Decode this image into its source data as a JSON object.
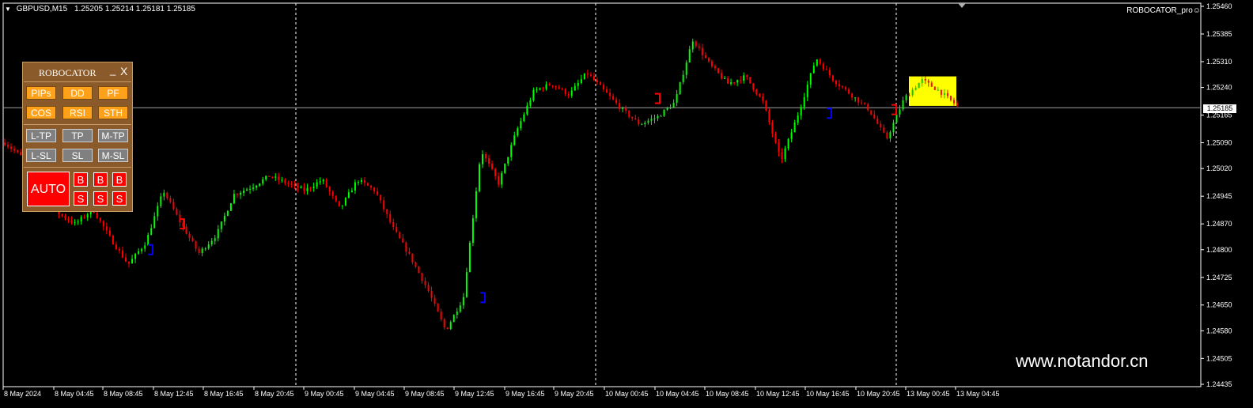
{
  "header": {
    "symbol": "GBPUSD,M15",
    "ohlc": "1.25205 1.25214 1.25181 1.25185"
  },
  "indicator_name": "ROBOCATOR_pro",
  "current_price": "1.25185",
  "watermark": "www.notandor.cn",
  "chart_data": {
    "type": "candlestick",
    "price_axis": [
      "1.25460",
      "1.25385",
      "1.25310",
      "1.25240",
      "1.25165",
      "1.25090",
      "1.25020",
      "1.24945",
      "1.24870",
      "1.24800",
      "1.24725",
      "1.24650",
      "1.24580",
      "1.24505",
      "1.24435"
    ],
    "ylim": [
      1.24435,
      1.2546
    ],
    "time_axis": [
      "8 May 2024",
      "8 May 04:45",
      "8 May 08:45",
      "8 May 12:45",
      "8 May 16:45",
      "8 May 20:45",
      "9 May 00:45",
      "9 May 04:45",
      "9 May 08:45",
      "9 May 12:45",
      "9 May 16:45",
      "9 May 20:45",
      "10 May 00:45",
      "10 May 04:45",
      "10 May 08:45",
      "10 May 12:45",
      "10 May 16:45",
      "10 May 20:45",
      "13 May 00:45",
      "13 May 04:45"
    ],
    "period_separators": [
      "9 May 00:45",
      "10 May 00:45",
      "13 May 00:45"
    ],
    "bid_line": 1.25185,
    "colors": {
      "bull": "#00ff00",
      "bear": "#ff0000",
      "bg": "#000000",
      "axis": "#ffffff",
      "zone": "#ffff00",
      "marker_buy": "#0000ff",
      "marker_sell": "#ff0000"
    },
    "path_anchors": [
      1.2509,
      1.2505,
      1.2495,
      1.249,
      1.2487,
      1.2491,
      1.2483,
      1.2476,
      1.2482,
      1.2496,
      1.2487,
      1.2479,
      1.2484,
      1.2495,
      1.2497,
      1.25,
      1.2498,
      1.2496,
      1.2499,
      1.2491,
      1.2499,
      1.2496,
      1.2486,
      1.2478,
      1.2469,
      1.2458,
      1.2467,
      1.2507,
      1.2498,
      1.2512,
      1.2523,
      1.2525,
      1.2522,
      1.2528,
      1.2523,
      1.2518,
      1.2514,
      1.2516,
      1.252,
      1.2537,
      1.253,
      1.2525,
      1.2527,
      1.252,
      1.2504,
      1.2517,
      1.2532,
      1.2526,
      1.2522,
      1.2518,
      1.251,
      1.2521,
      1.2526,
      1.2523,
      1.2519
    ],
    "markers": [
      {
        "type": "buy",
        "price": 1.248
      },
      {
        "type": "sell",
        "price": 1.2487
      },
      {
        "type": "buy",
        "price": 1.2467
      },
      {
        "type": "sell",
        "price": 1.2521
      },
      {
        "type": "buy",
        "price": 1.2517
      },
      {
        "type": "sell",
        "price": 1.2518
      }
    ],
    "zone": {
      "top": 1.2527,
      "bottom": 1.2519
    }
  },
  "panel": {
    "title": "ROBOCATOR",
    "minimize": "_",
    "close": "X",
    "row1": [
      "PIPs",
      "DD",
      "PF"
    ],
    "row2": [
      "COS",
      "RSI",
      "STH"
    ],
    "row3": [
      "L-TP",
      "TP",
      "M-TP"
    ],
    "row4": [
      "L-SL",
      "SL",
      "M-SL"
    ],
    "auto": "AUTO",
    "buy": [
      "B",
      "B",
      "B"
    ],
    "sell": [
      "S",
      "S",
      "S"
    ]
  }
}
